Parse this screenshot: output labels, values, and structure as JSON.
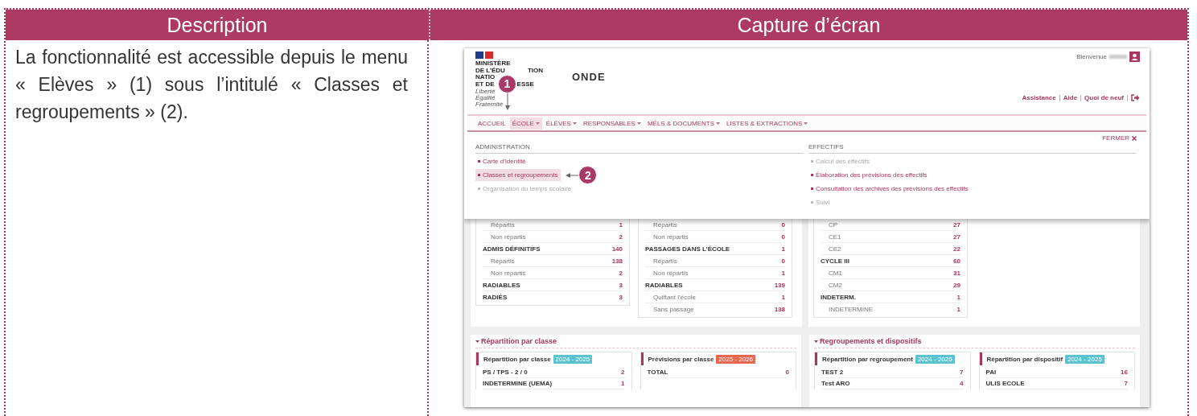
{
  "table": {
    "headers": [
      "Description",
      "Capture d’écran"
    ],
    "description": "La fonctionnalité est accessible depuis le menu « Elèves » (1) sous l’intitulé « Classes et regroupements » (2)."
  },
  "screenshot": {
    "logo_lines": [
      {
        "left": "MINISTÈRE"
      },
      {
        "left": "DE L’ÉDU",
        "right": "TION"
      },
      {
        "left": "NATIO"
      },
      {
        "left": "ET DE",
        "right": "ESSE"
      }
    ],
    "motto": [
      "Liberté",
      "Égalité",
      "Fraternité"
    ],
    "app_title": "ONDE",
    "welcome": "Bienvenue",
    "top_links": [
      "Assistance",
      "Aide",
      "Quoi de neuf"
    ],
    "nav": [
      {
        "label": "ACCUEIL",
        "dropdown": false,
        "selected": false
      },
      {
        "label": "ÉCOLE",
        "dropdown": true,
        "selected": true
      },
      {
        "label": "ÉLÈVES",
        "dropdown": true,
        "selected": false
      },
      {
        "label": "RESPONSABLES",
        "dropdown": true,
        "selected": false
      },
      {
        "label": "MÉLS & DOCUMENTS",
        "dropdown": true,
        "selected": false
      },
      {
        "label": "LISTES & EXTRACTIONS",
        "dropdown": true,
        "selected": false
      }
    ],
    "close_label": "FERMER",
    "menu_columns": [
      {
        "heading": "ADMINISTRATION",
        "items": [
          {
            "label": "Carte d’identité",
            "disabled": false,
            "selected": false
          },
          {
            "label": "Classes et regroupements",
            "disabled": false,
            "selected": true
          },
          {
            "label": "Organisation du temps scolaire",
            "disabled": true,
            "selected": false
          }
        ]
      },
      {
        "heading": "EFFECTIFS",
        "items": [
          {
            "label": "Calcul des effectifs",
            "disabled": true,
            "selected": false
          },
          {
            "label": "Élaboration des prévisions des effectifs",
            "disabled": false,
            "selected": false
          },
          {
            "label": "Consultation des archives des prévisions des effectifs",
            "disabled": false,
            "selected": false
          },
          {
            "label": "Suivi",
            "disabled": true,
            "selected": false
          }
        ]
      }
    ],
    "callouts": [
      "1",
      "2"
    ],
    "stat_groups": [
      [
        [
          {
            "label": "Répartis",
            "value": "1",
            "kind": "sub"
          },
          {
            "label": "Non répartis",
            "value": "2",
            "kind": "sub"
          },
          {
            "label": "ADMIS DÉFINITIFS",
            "value": "140",
            "kind": "total"
          },
          {
            "label": "Répartis",
            "value": "138",
            "kind": "sub"
          },
          {
            "label": "Non répartis",
            "value": "2",
            "kind": "sub"
          },
          {
            "label": "RADIABLES",
            "value": "3",
            "kind": "total"
          },
          {
            "label": "RADIÉS",
            "value": "3",
            "kind": "total"
          }
        ],
        [
          {
            "label": "Répartis",
            "value": "0",
            "kind": "sub"
          },
          {
            "label": "Non répartis",
            "value": "0",
            "kind": "sub"
          },
          {
            "label": "PASSAGES DANS L’ÉCOLE",
            "value": "1",
            "kind": "total"
          },
          {
            "label": "Répartis",
            "value": "0",
            "kind": "sub"
          },
          {
            "label": "Non répartis",
            "value": "1",
            "kind": "sub"
          },
          {
            "label": "RADIABLES",
            "value": "139",
            "kind": "total"
          },
          {
            "label": "Quittant l’école",
            "value": "1",
            "kind": "sub"
          },
          {
            "label": "Sans passage",
            "value": "138",
            "kind": "sub"
          }
        ]
      ],
      [
        [
          {
            "label": "CP",
            "value": "27",
            "kind": "sub"
          },
          {
            "label": "CE1",
            "value": "27",
            "kind": "sub"
          },
          {
            "label": "CE2",
            "value": "22",
            "kind": "sub"
          },
          {
            "label": "CYCLE III",
            "value": "60",
            "kind": "total"
          },
          {
            "label": "CM1",
            "value": "31",
            "kind": "sub"
          },
          {
            "label": "CM2",
            "value": "29",
            "kind": "sub"
          },
          {
            "label": "INDETERM.",
            "value": "1",
            "kind": "total"
          },
          {
            "label": "INDETERMINE",
            "value": "1",
            "kind": "sub"
          }
        ]
      ]
    ],
    "sections": [
      {
        "title": "Répartition par classe",
        "cards": [
          {
            "title": "Répartition par classe",
            "badge": "2024 - 2025",
            "color": "#5bc2cf",
            "rows": [
              {
                "label": "PS / TPS - 2 / 0",
                "value": "2"
              },
              {
                "label": "INDETERMINE (UEMA)",
                "value": "1"
              }
            ]
          },
          {
            "title": "Prévisions par classe",
            "badge": "2025 - 2026",
            "color": "#e8674f",
            "rows": [
              {
                "label": "TOTAL",
                "value": "0"
              }
            ]
          }
        ]
      },
      {
        "title": "Regroupements et dispositifs",
        "cards": [
          {
            "title": "Répartition par regroupement",
            "badge": "2024 - 2025",
            "color": "#5bc2cf",
            "rows": [
              {
                "label": "TEST 2",
                "value": "7"
              },
              {
                "label": "Test ARO",
                "value": "4"
              }
            ]
          },
          {
            "title": "Répartition par dispositif",
            "badge": "2024 - 2025",
            "color": "#5bc2cf",
            "rows": [
              {
                "label": "PAI",
                "value": "16"
              },
              {
                "label": "ULIS ECOLE",
                "value": "7"
              }
            ]
          }
        ]
      }
    ]
  }
}
